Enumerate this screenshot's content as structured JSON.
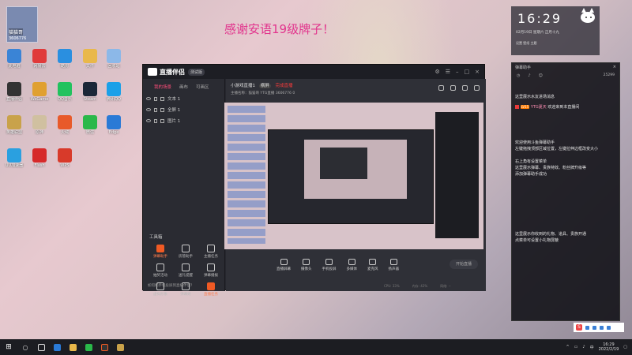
{
  "overlay_text": "感谢安语19级牌子！",
  "streamer_badge": {
    "name": "猫猫哥",
    "id": "3606776"
  },
  "desktop_icons": [
    {
      "name": "此电脑",
      "color": "#3a84d6"
    },
    {
      "name": "网易云",
      "color": "#e03a3a"
    },
    {
      "name": "酷狗",
      "color": "#2a8fe0"
    },
    {
      "name": "文件",
      "color": "#e9b84a"
    },
    {
      "name": "回收站",
      "color": "#8cb8e8"
    },
    {
      "name": "直播伴侣",
      "color": "#333"
    },
    {
      "name": "WeGame",
      "color": "#e0a030"
    },
    {
      "name": "QQ音乐",
      "color": "#21c25e"
    },
    {
      "name": "Steam",
      "color": "#1b2838"
    },
    {
      "name": "腾讯QQ",
      "color": "#1aa0e8"
    },
    {
      "name": "英雄联盟",
      "color": "#c9a24a"
    },
    {
      "name": "原神",
      "color": "#d0c0a0"
    },
    {
      "name": "火绒",
      "color": "#e85a2a"
    },
    {
      "name": "微信",
      "color": "#2ab84a"
    },
    {
      "name": "Edge",
      "color": "#2a7ad6"
    },
    {
      "name": "UU加速器",
      "color": "#2aa0e0"
    },
    {
      "name": "Flash",
      "color": "#d62a2a"
    },
    {
      "name": "WPS",
      "color": "#d83a2a"
    }
  ],
  "app": {
    "title": "直播伴侣",
    "version": "测试版",
    "tabs": [
      "我的场景",
      "画布",
      "可画区"
    ],
    "sources": [
      "文本 1",
      "全屏 1",
      "图片 1"
    ],
    "tools_title": "工具箱",
    "tools": [
      {
        "label": "弹幕助手",
        "hot": true
      },
      {
        "label": "房管助手",
        "hot": false
      },
      {
        "label": "主播任务",
        "hot": false
      },
      {
        "label": "抽奖活动",
        "hot": false
      },
      {
        "label": "送礼提醒",
        "hot": false
      },
      {
        "label": "弹幕播报",
        "hot": false
      },
      {
        "label": "虚拟形象",
        "hot": false
      },
      {
        "label": "弹幕姬",
        "hot": false
      },
      {
        "label": "直播任务",
        "hot": true
      }
    ],
    "bottom_hint": "如何把手机投屏到直播伴侣？",
    "scene": {
      "title": "小游戏直播1",
      "badge": "横屏",
      "red_label": "完成直播",
      "sub": "主播名称：猫猫哥    YTG直播    3606776    0"
    },
    "controls": [
      "直播屏幕",
      "摄像头",
      "手机投屏",
      "多媒体",
      "麦克风",
      "扬声器"
    ],
    "start_button": "开始直播",
    "status": [
      "CPU: 33%",
      "内存: 42%",
      "网络: --"
    ]
  },
  "clock": {
    "time": "16:29",
    "date": "02月19日 星期六",
    "lunar": "正月十九",
    "row2": "设置  壁纸  主题"
  },
  "chat": {
    "header": "弹幕助手",
    "tabs": [
      "◷",
      "♪",
      "☺"
    ],
    "fans": "25299",
    "messages": [
      {
        "text": "这里展示水友进场消息"
      },
      {
        "level": "LV15",
        "user": "YTG夏天",
        "text": "欢迎来到本直播间"
      },
      {
        "text": "欢迎使用斗鱼弹幕助手"
      },
      {
        "text": "左键拖拽顶部区域位置，左键拉伸边框改变大小"
      },
      {
        "text": "右上角有设置菜单"
      },
      {
        "text": "这里展示弹幕、贵族特效、粉丝牌升级等"
      },
      {
        "text": "添加弹幕助手成功"
      },
      {
        "text": "这里展示你收到的礼物、道具、贵族开通"
      },
      {
        "text": "点菜单可设置小礼物屏蔽"
      }
    ]
  },
  "taskbar": {
    "time": "16:29",
    "date": "2022/2/19"
  }
}
